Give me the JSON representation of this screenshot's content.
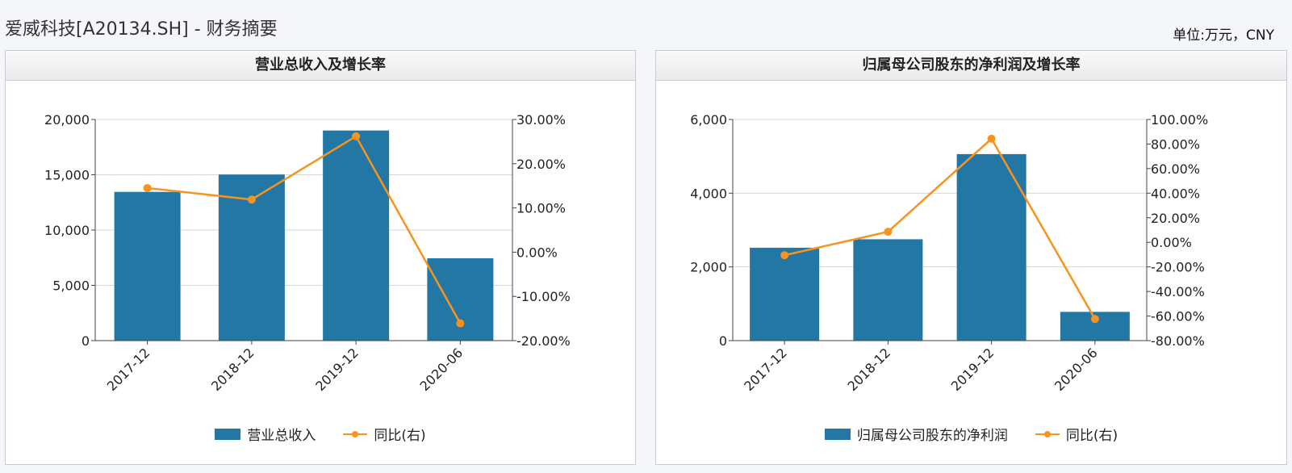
{
  "page": {
    "title": "爱威科技[A20134.SH] - 财务摘要",
    "unit": "单位:万元，CNY"
  },
  "colors": {
    "bar": "#2377a4",
    "line": "#f7931e",
    "grid": "#d6d6d6",
    "axis": "#444444"
  },
  "chart_data": [
    {
      "type": "bar",
      "title": "营业总收入及增长率",
      "categories": [
        "2017-12",
        "2018-12",
        "2019-12",
        "2020-06"
      ],
      "series": [
        {
          "name": "营业总收入",
          "type": "bar",
          "axis": "left",
          "values": [
            13450,
            15020,
            19000,
            7450
          ]
        },
        {
          "name": "同比(右)",
          "type": "line",
          "axis": "right",
          "values": [
            14.5,
            11.9,
            26.2,
            -16.1
          ]
        }
      ],
      "left_axis": {
        "ylim": [
          0,
          20000
        ],
        "ticks": [
          0,
          5000,
          10000,
          15000,
          20000
        ],
        "tick_labels": [
          "0",
          "5,000",
          "10,000",
          "15,000",
          "20,000"
        ]
      },
      "right_axis": {
        "ylim": [
          -20,
          30
        ],
        "ticks": [
          -20,
          -10,
          0,
          10,
          20,
          30
        ],
        "tick_labels": [
          "-20.00%",
          "-10.00%",
          "0.00%",
          "10.00%",
          "20.00%",
          "30.00%"
        ]
      },
      "grid": true,
      "legend": "bottom-center"
    },
    {
      "type": "bar",
      "title": "归属母公司股东的净利润及增长率",
      "categories": [
        "2017-12",
        "2018-12",
        "2019-12",
        "2020-06"
      ],
      "series": [
        {
          "name": "归属母公司股东的净利润",
          "type": "bar",
          "axis": "left",
          "values": [
            2520,
            2750,
            5060,
            780
          ]
        },
        {
          "name": "同比(右)",
          "type": "line",
          "axis": "right",
          "values": [
            -10.5,
            8.6,
            84.3,
            -62.4
          ]
        }
      ],
      "left_axis": {
        "ylim": [
          0,
          6000
        ],
        "ticks": [
          0,
          2000,
          4000,
          6000
        ],
        "tick_labels": [
          "0",
          "2,000",
          "4,000",
          "6,000"
        ]
      },
      "right_axis": {
        "ylim": [
          -80,
          100
        ],
        "ticks": [
          -80,
          -60,
          -40,
          -20,
          0,
          20,
          40,
          60,
          80,
          100
        ],
        "tick_labels": [
          "-80.00%",
          "-60.00%",
          "-40.00%",
          "-20.00%",
          "0.00%",
          "20.00%",
          "40.00%",
          "60.00%",
          "80.00%",
          "100.00%"
        ]
      },
      "grid": true,
      "legend": "bottom-center"
    }
  ]
}
